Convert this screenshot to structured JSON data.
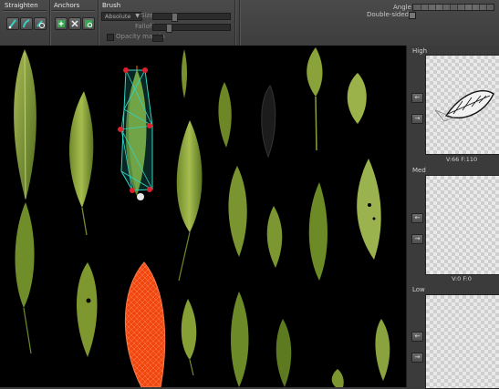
{
  "toolbar": {
    "straighten": {
      "title": "Straighten",
      "buttons": [
        "straighten-leaf-icon",
        "straighten-bend-icon",
        "straighten-reset-icon"
      ]
    },
    "anchors": {
      "title": "Anchors",
      "buttons": [
        "anchor-add-icon",
        "anchor-delete-icon",
        "anchor-reset-icon"
      ]
    },
    "brush": {
      "title": "Brush",
      "mode": "Absolute",
      "size_label": "Size",
      "falloff_label": "Falloff",
      "opacity_margin_label": "Opacity margin"
    },
    "angle_label": "Angle",
    "double_sided_label": "Double-sided"
  },
  "previews": [
    {
      "title": "High",
      "info": "V:66  F:110",
      "has_mesh": true
    },
    {
      "title": "Med",
      "info": "V:0  F:0",
      "has_mesh": false
    },
    {
      "title": "Low",
      "info": "",
      "has_mesh": false
    }
  ],
  "colors": {
    "mesh": "#2fd5c4",
    "anchor": "#e0202a",
    "brush": "#ff4a12"
  }
}
